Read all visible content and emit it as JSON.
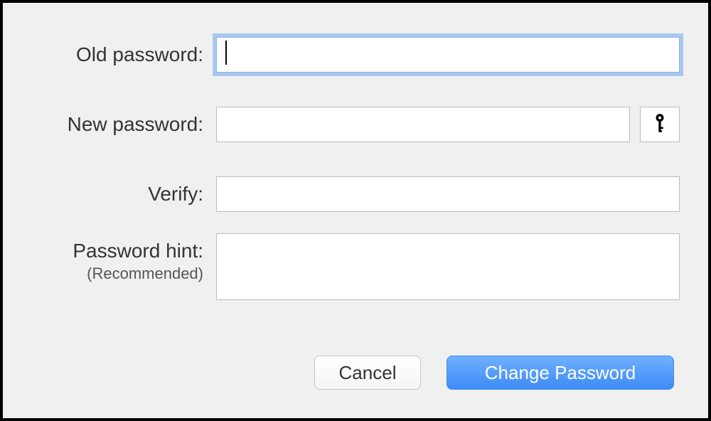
{
  "fields": {
    "old_password": {
      "label": "Old password:",
      "value": ""
    },
    "new_password": {
      "label": "New password:",
      "value": ""
    },
    "verify": {
      "label": "Verify:",
      "value": ""
    },
    "hint": {
      "label": "Password hint:",
      "sublabel": "(Recommended)",
      "value": ""
    }
  },
  "buttons": {
    "password_assistant_icon": "key-icon",
    "cancel": "Cancel",
    "change_password": "Change Password"
  }
}
